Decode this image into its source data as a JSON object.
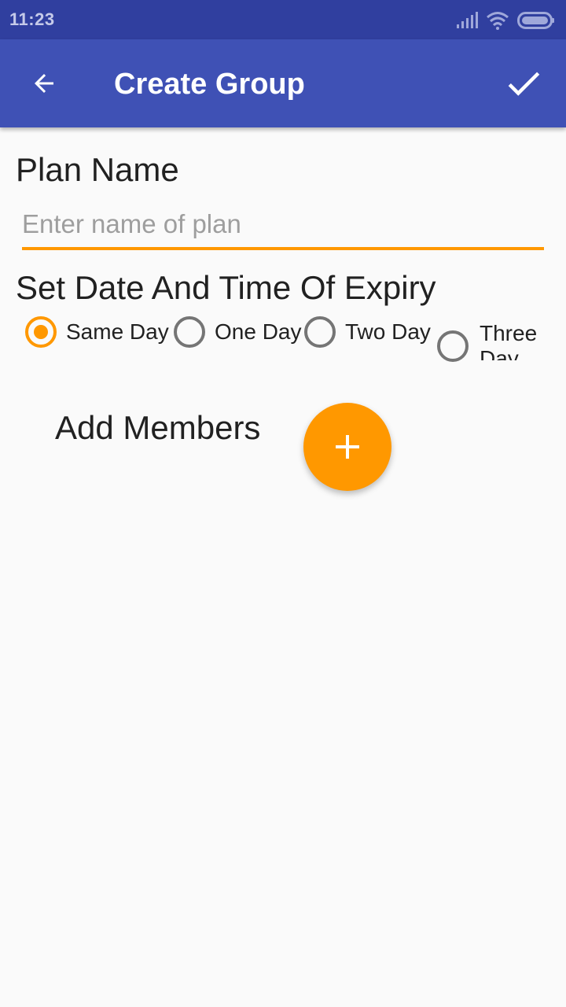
{
  "status_bar": {
    "time": "11:23",
    "icons": [
      "signal-icon",
      "wifi-icon",
      "battery-icon"
    ]
  },
  "toolbar": {
    "title": "Create Group",
    "back_icon": "arrow-back-icon",
    "confirm_icon": "check-icon",
    "background_color": "#3f51b5"
  },
  "plan": {
    "label": "Plan Name",
    "value": "",
    "placeholder": "Enter name of plan"
  },
  "expiry": {
    "label": "Set Date And Time Of Expiry",
    "options": [
      {
        "label": "Same Day",
        "checked": true
      },
      {
        "label": "One Day",
        "checked": false
      },
      {
        "label": "Two Day",
        "checked": false
      },
      {
        "label": "Three Day",
        "checked": false
      }
    ]
  },
  "members": {
    "label": "Add Members",
    "add_icon": "plus-icon"
  },
  "colors": {
    "accent": "#ff9800",
    "primary": "#3f51b5",
    "primary_dark": "#303f9f"
  }
}
